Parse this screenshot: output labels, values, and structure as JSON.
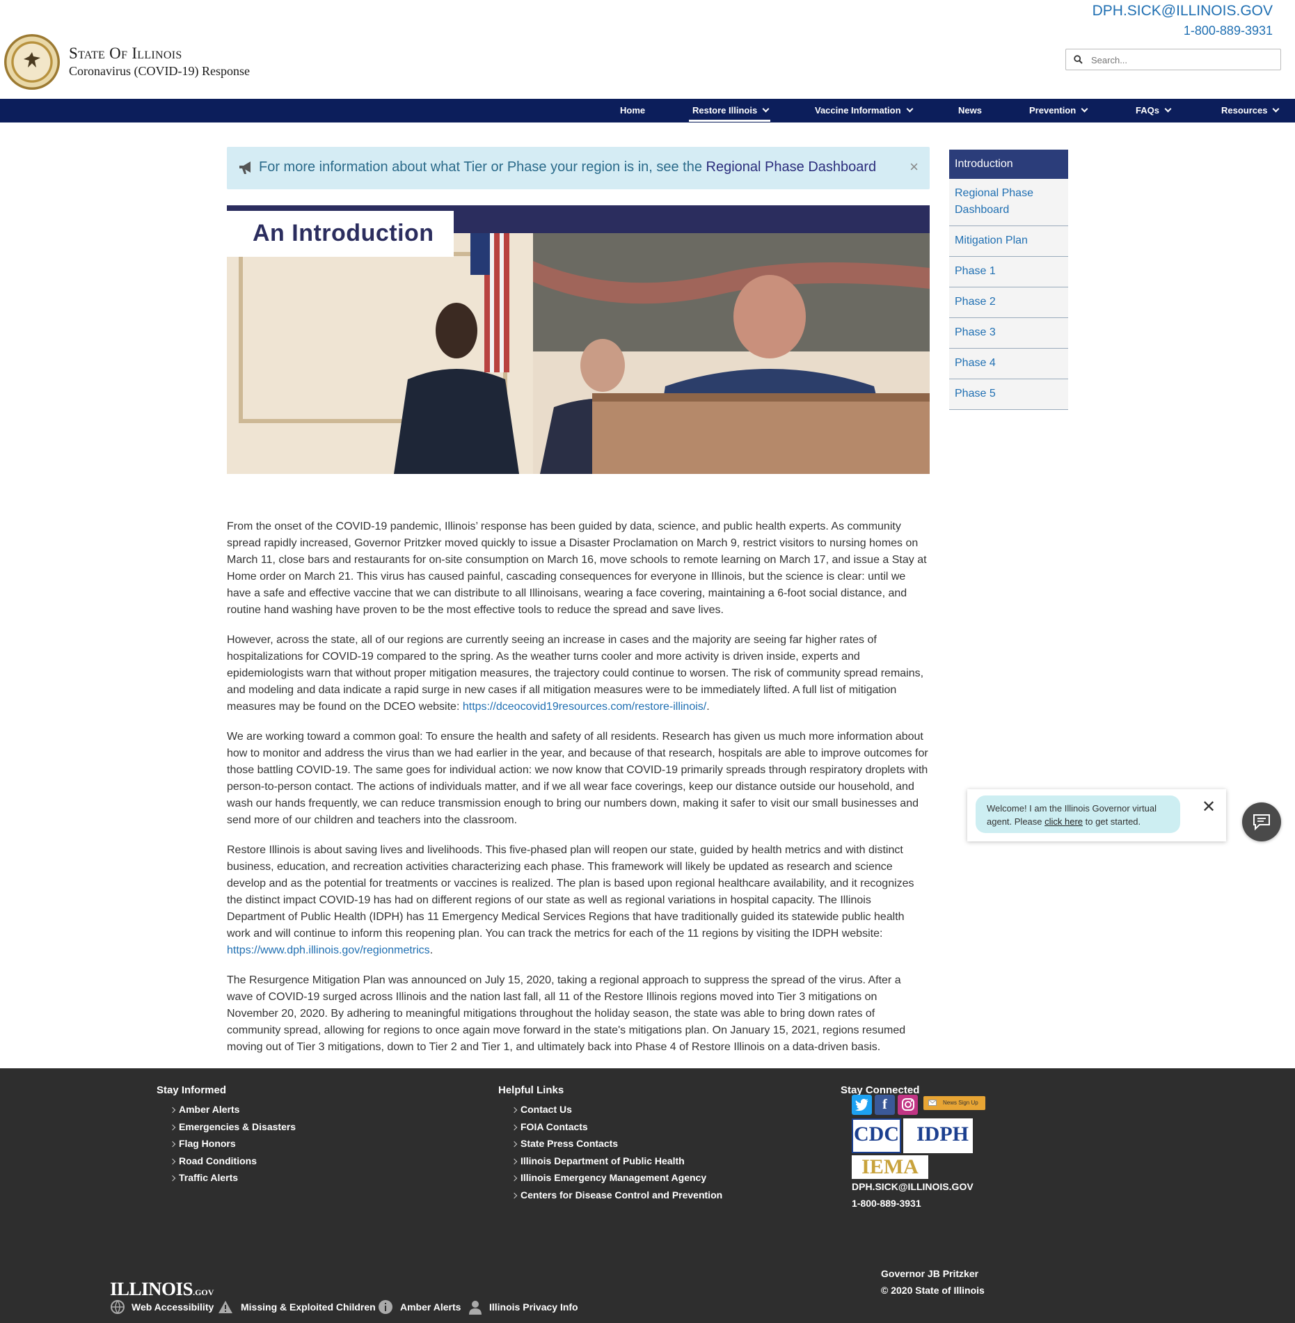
{
  "header": {
    "title": "State Of Illinois",
    "subtitle": "Coronavirus (COVID-19) Response",
    "email": "DPH.SICK@ILLINOIS.GOV",
    "phone": "1-800-889-3931",
    "search_placeholder": "Search..."
  },
  "nav": {
    "items": [
      {
        "label": "Home",
        "dropdown": false
      },
      {
        "label": "Restore Illinois",
        "dropdown": true,
        "active": true
      },
      {
        "label": "Vaccine Information",
        "dropdown": true
      },
      {
        "label": "News",
        "dropdown": false
      },
      {
        "label": "Prevention",
        "dropdown": true
      },
      {
        "label": "FAQs",
        "dropdown": true
      },
      {
        "label": "Resources",
        "dropdown": true
      }
    ]
  },
  "alert": {
    "icon": "megaphone-icon",
    "text": "For more information about what Tier or Phase your region is in, see the ",
    "link": "Regional Phase Dashboard",
    "close": "×"
  },
  "hero": {
    "title": "An Introduction"
  },
  "sidebar": {
    "heading": "Introduction",
    "items": [
      "Regional Phase Dashboard",
      "Mitigation Plan",
      "Phase 1",
      "Phase 2",
      "Phase 3",
      "Phase 4",
      "Phase 5"
    ]
  },
  "content": {
    "p1": "From the onset of the COVID-19 pandemic, Illinois’ response has been guided by data, science, and public health experts. As community spread rapidly increased, Governor Pritzker moved quickly to issue a Disaster Proclamation on March 9, restrict visitors to nursing homes on March 11, close bars and restaurants for on-site consumption on March 16, move schools to remote learning on March 17, and issue a Stay at Home order on March 21. This virus has caused painful, cascading consequences for everyone in Illinois, but the science is clear: until we have a safe and effective vaccine that we can distribute to all Illinoisans, wearing a face covering, maintaining a 6-foot social distance, and routine hand washing have proven to be the most effective tools to reduce the spread and save lives.",
    "p2": "However, across the state, all of our regions are currently seeing an increase in cases and the majority are seeing far higher rates of hospitalizations for COVID-19 compared to the spring. As the weather turns cooler and more activity is driven inside, experts and epidemiologists warn that without proper mitigation measures, the trajectory could continue to worsen. The risk of community spread remains, and modeling and data indicate a rapid surge in new cases if all mitigation measures were to be immediately lifted. A full list of mitigation measures may be found on the DCEO website: ",
    "p2_link": "https://dceocovid19resources.com/restore-illinois/",
    "p2_end": ".",
    "p3": "We are working toward a common goal: To ensure the health and safety of all residents. Research has given us much more information about how to monitor and address the virus than we had earlier in the year, and because of that research, hospitals are able to improve outcomes for those battling COVID-19. The same goes for individual action: we now know that COVID-19 primarily spreads through respiratory droplets with person-to-person contact. The actions of individuals matter, and if we all wear face coverings, keep our distance outside our household, and wash our hands frequently, we can reduce transmission enough to bring our numbers down, making it safer to visit our small businesses and send more of our children and teachers into the classroom.",
    "p4": "Restore Illinois is about saving lives and livelihoods. This five-phased plan will reopen our state, guided by health metrics and with distinct business, education, and recreation activities characterizing each phase. This framework will likely be updated as research and science develop and as the potential for treatments or vaccines is realized. The plan is based upon regional healthcare availability, and it recognizes the distinct impact COVID-19 has had on different regions of our state as well as regional variations in hospital capacity. The Illinois Department of Public Health (IDPH) has 11 Emergency Medical Services Regions that have traditionally guided its statewide public health work and will continue to inform this reopening plan.  You can track the metrics for each of the 11 regions by visiting the IDPH website: ",
    "p4_link": "https://www.dph.illinois.gov/regionmetrics",
    "p4_end": ".",
    "p5": "The Resurgence Mitigation Plan was announced on July 15, 2020, taking a regional approach to suppress the spread of the virus. After a wave of COVID-19 surged across Illinois and the nation last fall, all 11 of the Restore Illinois regions moved into Tier 3 mitigations on November 20, 2020. By adhering to meaningful mitigations throughout the holiday season, the state was able to bring down rates of community spread, allowing for regions to once again move forward in the state's mitigations plan. On January 15, 2021, regions resumed moving out of Tier 3 mitigations, down to Tier 2 and Tier 1, and ultimately back into Phase 4 of Restore Illinois on a data-driven basis."
  },
  "chat": {
    "text_before": "Welcome! I am the Illinois Governor virtual agent. Please ",
    "link": "click here",
    "text_after": " to get started.",
    "close": "✕"
  },
  "footer": {
    "stay_informed": {
      "title": "Stay Informed",
      "items": [
        "Amber Alerts",
        "Emergencies & Disasters",
        "Flag Honors",
        "Road Conditions",
        "Traffic Alerts"
      ]
    },
    "helpful_links": {
      "title": "Helpful Links",
      "items": [
        "Contact Us",
        "FOIA Contacts",
        "State Press Contacts",
        "Illinois Department of Public Health",
        "Illinois Emergency Management Agency",
        "Centers for Disease Control and Prevention"
      ]
    },
    "stay_connected": {
      "title": "Stay Connected",
      "news_signup": "News Sign Up",
      "cdc": "CDC",
      "idph": "IDPH",
      "iema": "IEMA",
      "email": "DPH.SICK@ILLINOIS.GOV",
      "phone": "1-800-889-3931"
    },
    "governor": "Governor JB Pritzker",
    "copyright": "© 2020 State of Illinois",
    "illinois_gov": "ILLINOIS",
    "illinois_gov_suffix": ".GOV",
    "bottom_links": [
      "Web Accessibility",
      "Missing & Exploited Children",
      "Amber Alerts",
      "Illinois Privacy Info"
    ],
    "colors": {
      "twitter": "#1da1f2",
      "facebook": "#3b5998",
      "instagram": "#c13584",
      "footer_bg": "#2e2e2e"
    }
  }
}
